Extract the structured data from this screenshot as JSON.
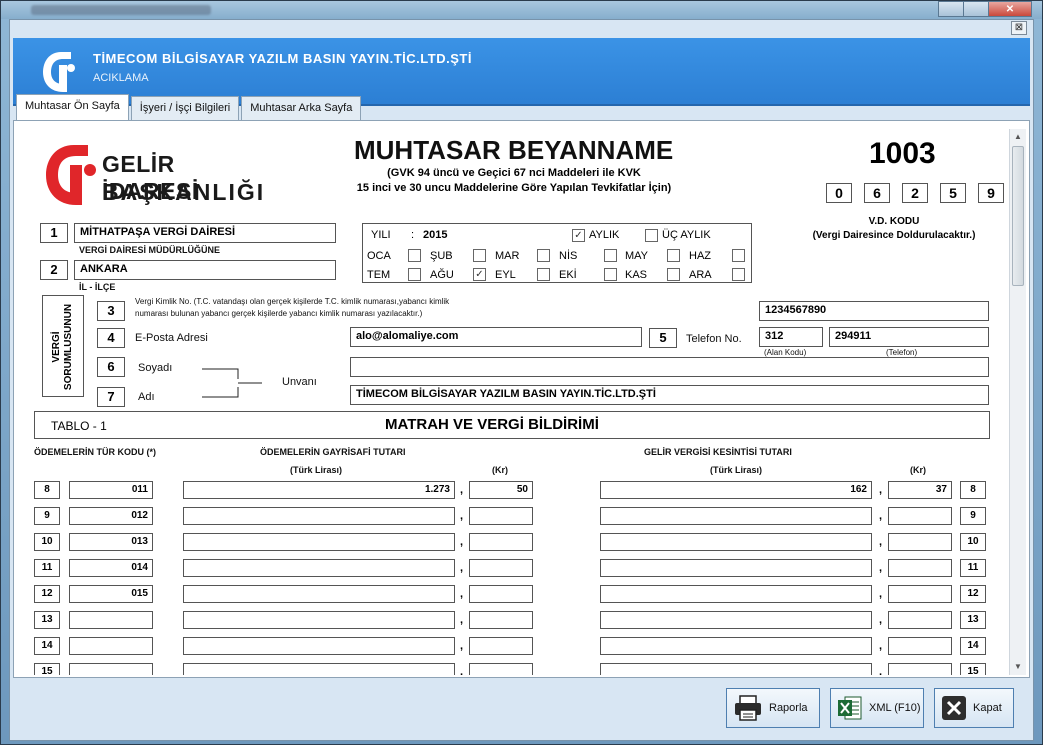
{
  "window": {
    "close_symbol": "✕",
    "inner_close_symbol": "⊠"
  },
  "banner": {
    "company": "TİMECOM BİLGİSAYAR YAZILM BASIN YAYIN.TİC.LTD.ŞTİ",
    "subtitle": "ACIKLAMA"
  },
  "tabs": [
    {
      "label": "Muhtasar Ön Sayfa"
    },
    {
      "label": "İşyeri / İşçi Bilgileri"
    },
    {
      "label": "Muhtasar Arka Sayfa"
    }
  ],
  "logo": {
    "line1": "GELİR İDARESİ",
    "line2": "BAŞKANLIĞI"
  },
  "header": {
    "title": "MUHTASAR BEYANNAME",
    "subtitle1": "(GVK 94 üncü ve Geçici 67 nci Maddeleri ile KVK",
    "subtitle2": "15 inci ve 30 uncu Maddelerine Göre Yapılan Tevkifatlar İçin)",
    "form_code": "1003",
    "vd_digits": [
      "0",
      "6",
      "2",
      "5",
      "9"
    ],
    "vd_label1": "V.D. KODU",
    "vd_label2": "(Vergi Dairesince Doldurulacaktır.)"
  },
  "section1": {
    "num": "1",
    "value": "MİTHATPAŞA VERGİ DAİRESİ",
    "label": "VERGİ DAİRESİ MÜDÜRLÜĞÜNE"
  },
  "section2": {
    "num": "2",
    "value": "ANKARA",
    "label": "İL - İLÇE"
  },
  "period": {
    "year_label": "YILI",
    "year_colon": ":",
    "year": "2015",
    "monthly_label": "AYLIK",
    "quarterly_label": "ÜÇ AYLIK",
    "months_row1": [
      "OCA",
      "ŞUB",
      "MAR",
      "NİS",
      "MAY",
      "HAZ"
    ],
    "months_row2": [
      "TEM",
      "AĞU",
      "EYL",
      "EKİ",
      "KAS",
      "ARA"
    ],
    "check_mark": "✓"
  },
  "taxpayer": {
    "side_label1": "VERGİ",
    "side_label2": "SORUMLUSUNUN",
    "f3_num": "3",
    "f3_label1": "Vergi  Kimlik No. (T.C. vatandaşı olan gerçek kişilerde T.C. kimlik numarası,yabancı kimlik",
    "f3_label2": "numarası bulunan yabancı gerçek kişilerde yabancı kimlik numarası yazılacaktır.)",
    "f3_value": "1234567890",
    "f4_num": "4",
    "f4_label": "E-Posta Adresi",
    "f4_value": "alo@alomaliye.com",
    "f5_num": "5",
    "f5_label": "Telefon No.",
    "area_code": "312",
    "phone": "294911",
    "area_code_label": "(Alan Kodu)",
    "phone_label": "(Telefon)",
    "f6_num": "6",
    "f6_label": "Soyadı",
    "f7_num": "7",
    "f7_label": "Adı",
    "unvan_label": "Unvanı",
    "unvan_value": "TİMECOM BİLGİSAYAR YAZILM BASIN YAYIN.TİC.LTD.ŞTİ"
  },
  "table": {
    "label": "TABLO - 1",
    "title": "MATRAH VE VERGİ BİLDİRİMİ",
    "col_type": "ÖDEMELERİN TÜR KODU (*)",
    "col_gross": "ÖDEMELERİN GAYRİSAFİ TUTARI",
    "col_tax": "GELİR VERGİSİ KESİNTİSİ TUTARI",
    "tl_label": "(Türk Lirası)",
    "kr_label": "(Kr)",
    "rows": [
      {
        "num": "8",
        "code": "011",
        "gross_tl": "1.273",
        "gross_kr": "50",
        "tax_tl": "162",
        "tax_kr": "37"
      },
      {
        "num": "9",
        "code": "012",
        "gross_tl": "",
        "gross_kr": "",
        "tax_tl": "",
        "tax_kr": ""
      },
      {
        "num": "10",
        "code": "013",
        "gross_tl": "",
        "gross_kr": "",
        "tax_tl": "",
        "tax_kr": ""
      },
      {
        "num": "11",
        "code": "014",
        "gross_tl": "",
        "gross_kr": "",
        "tax_tl": "",
        "tax_kr": ""
      },
      {
        "num": "12",
        "code": "015",
        "gross_tl": "",
        "gross_kr": "",
        "tax_tl": "",
        "tax_kr": ""
      },
      {
        "num": "13",
        "code": "",
        "gross_tl": "",
        "gross_kr": "",
        "tax_tl": "",
        "tax_kr": ""
      },
      {
        "num": "14",
        "code": "",
        "gross_tl": "",
        "gross_kr": "",
        "tax_tl": "",
        "tax_kr": ""
      },
      {
        "num": "15",
        "code": "",
        "gross_tl": "",
        "gross_kr": "",
        "tax_tl": "",
        "tax_kr": ""
      }
    ],
    "comma": ","
  },
  "buttons": {
    "report": "Raporla",
    "xml": "XML (F10)",
    "close": "Kapat"
  },
  "icons": {
    "scroll_up": "▲",
    "scroll_down": "▼"
  },
  "colors": {
    "banner": "#2c7fd4",
    "logo_red": "#e0262a"
  }
}
